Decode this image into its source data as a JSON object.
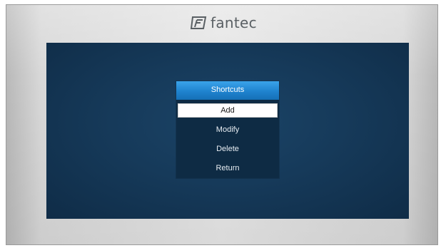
{
  "brand": {
    "logo_text": "fantec",
    "logo_icon": "fantec-logo-icon",
    "color": "#5a6064"
  },
  "menu": {
    "title": "Shortcuts",
    "items": [
      {
        "label": "Add",
        "selected": true
      },
      {
        "label": "Modify",
        "selected": false
      },
      {
        "label": "Delete",
        "selected": false
      },
      {
        "label": "Return",
        "selected": false
      }
    ]
  },
  "colors": {
    "screen_background": "#163a5a",
    "menu_background": "#0e2b44",
    "title_bar": "#1f83cf",
    "selected_item": "#ffffff"
  }
}
